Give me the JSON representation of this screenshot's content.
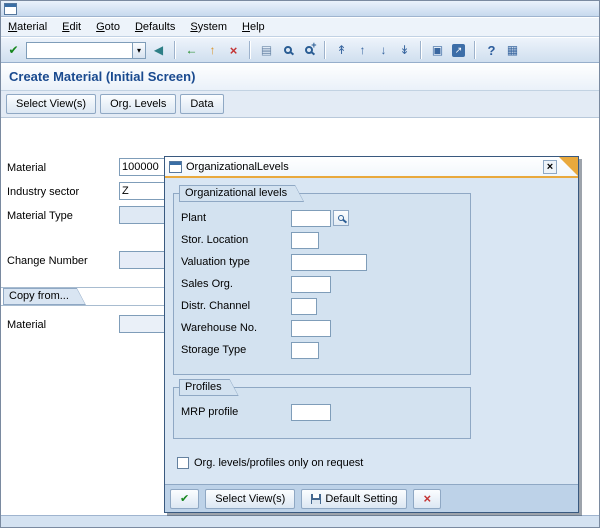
{
  "window": {
    "menubar": [
      "Material",
      "Edit",
      "Goto",
      "Defaults",
      "System",
      "Help"
    ],
    "command_field_value": "",
    "screen_title": "Create Material (Initial Screen)"
  },
  "icons": {
    "enter": "✔",
    "dropdown": "▾",
    "command_collapse": "◀",
    "back": "←",
    "exit": "↑",
    "cancel": "×",
    "print": "▤",
    "first_page": "↟",
    "prev_page": "↑",
    "next_page": "↓",
    "last_page": "↡",
    "new_session": "▣",
    "shortcut": "↗",
    "help": "?",
    "customize": "▦",
    "close": "×",
    "confirm": "✔"
  },
  "app_toolbar": {
    "select_views": "Select View(s)",
    "org_levels": "Org. Levels",
    "data": "Data"
  },
  "form": {
    "material": {
      "label": "Material",
      "value": "100000"
    },
    "industry_sector": {
      "label": "Industry sector",
      "value": "Z"
    },
    "material_type": {
      "label": "Material Type",
      "value": ""
    },
    "change_number": {
      "label": "Change Number",
      "value": ""
    },
    "copy_from": {
      "title": "Copy from...",
      "material": {
        "label": "Material",
        "value": ""
      }
    }
  },
  "dialog": {
    "title": "OrganizationalLevels",
    "org_group": {
      "title": "Organizational levels",
      "fields": [
        {
          "label": "Plant",
          "value": ""
        },
        {
          "label": "Stor. Location",
          "value": ""
        },
        {
          "label": "Valuation type",
          "value": ""
        },
        {
          "label": "Sales Org.",
          "value": ""
        },
        {
          "label": "Distr. Channel",
          "value": ""
        },
        {
          "label": "Warehouse No.",
          "value": ""
        },
        {
          "label": "Storage Type",
          "value": ""
        }
      ]
    },
    "profiles_group": {
      "title": "Profiles",
      "fields": [
        {
          "label": "MRP profile",
          "value": ""
        }
      ]
    },
    "request_checkbox": {
      "label": "Org. levels/profiles only on request",
      "checked": false
    },
    "footer": {
      "select_views": "Select View(s)",
      "default_setting": "Default Setting"
    }
  },
  "colors": {
    "mandatory_field_bg": "#fbf6b4",
    "screen_title_color": "#1a4a8f",
    "dialog_accent": "#e9a93d"
  }
}
